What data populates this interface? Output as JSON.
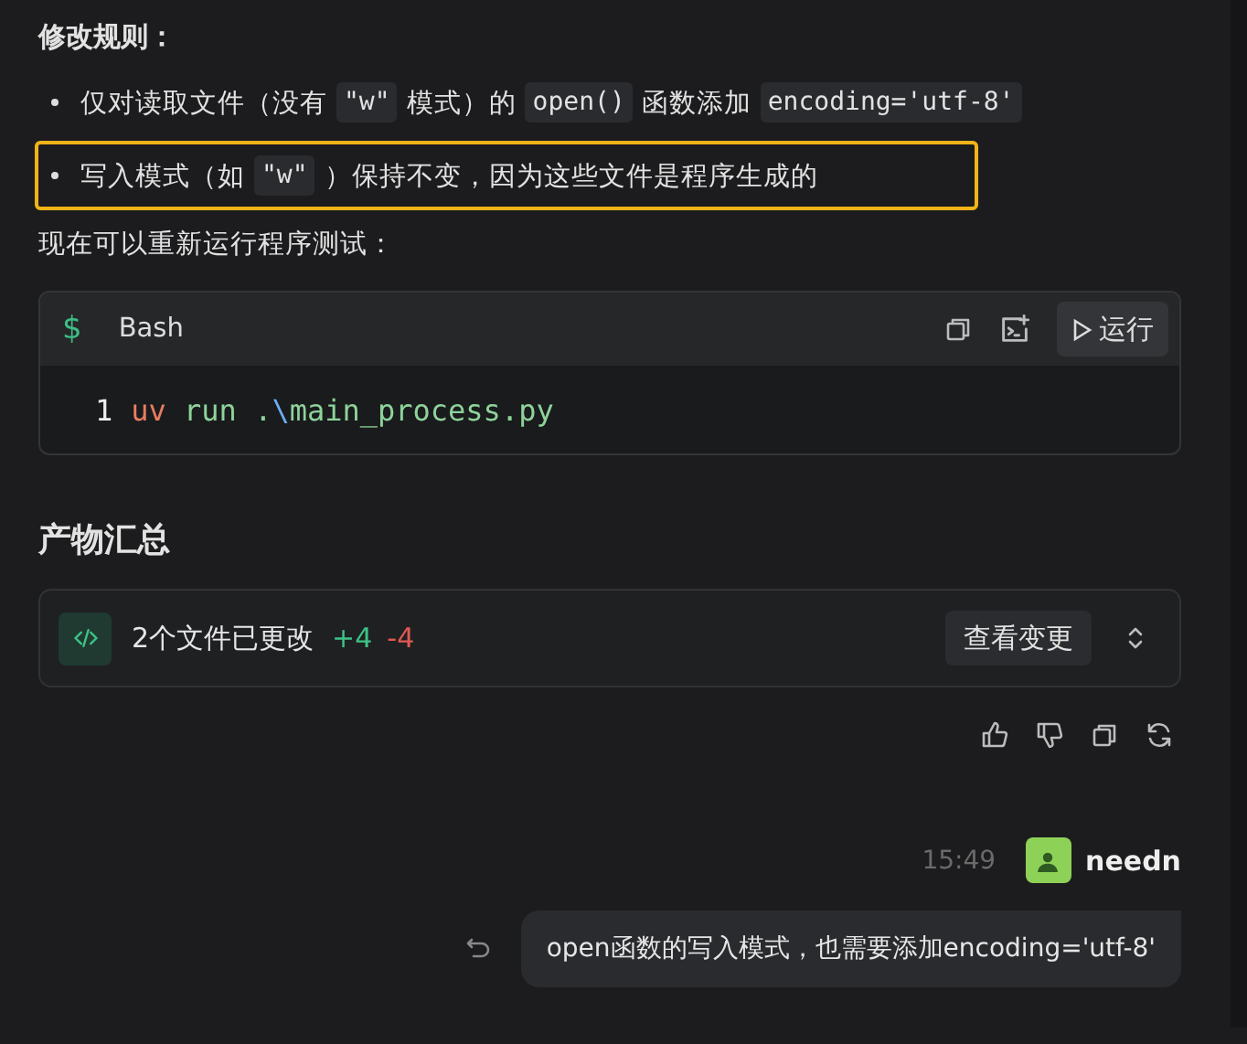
{
  "rules_heading": "修改规则：",
  "bullets": [
    {
      "highlighted": false,
      "parts": [
        {
          "kind": "text",
          "text": "仅对读取文件（没有"
        },
        {
          "kind": "code",
          "text": "\"w\""
        },
        {
          "kind": "text",
          "text": "模式）的"
        },
        {
          "kind": "code",
          "text": "open()"
        },
        {
          "kind": "text",
          "text": "函数添加"
        },
        {
          "kind": "code",
          "text": "encoding='utf-8'"
        }
      ]
    },
    {
      "highlighted": true,
      "parts": [
        {
          "kind": "text",
          "text": "写入模式（如"
        },
        {
          "kind": "code",
          "text": "\"w\""
        },
        {
          "kind": "text",
          "text": "）保持不变，因为这些文件是程序生成的"
        }
      ]
    }
  ],
  "intro": "现在可以重新运行程序测试：",
  "code_block": {
    "prompt": "$",
    "language": "Bash",
    "run_label": "运行",
    "lines": [
      {
        "number": "1",
        "tokens": [
          {
            "kind": "command",
            "text": "uv"
          },
          {
            "kind": "arg",
            "text": " run ."
          },
          {
            "kind": "escape",
            "text": "\\"
          },
          {
            "kind": "arg",
            "text": "main_process.py"
          }
        ]
      }
    ]
  },
  "summary_heading": "产物汇总",
  "changes": {
    "label": "2个文件已更改",
    "added": "+4",
    "removed": "-4",
    "button": "查看变更"
  },
  "message": {
    "time": "15:49",
    "user": "needn",
    "text": "open函数的写入模式，也需要添加encoding='utf-8'"
  }
}
